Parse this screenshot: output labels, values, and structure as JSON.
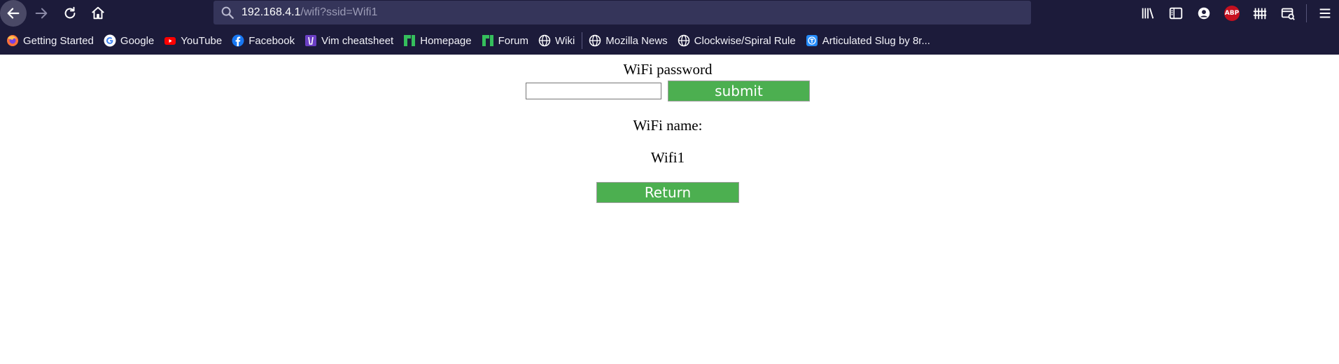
{
  "browser": {
    "url_host": "192.168.4.1",
    "url_path": "/wifi?ssid=Wifi1",
    "icons": [
      "back-arrow-icon",
      "forward-arrow-icon",
      "reload-icon",
      "home-icon",
      "search-icon",
      "library-icon",
      "sidebar-icon",
      "account-icon",
      "adblock-plus-icon",
      "tile-icon",
      "screenshot-icon",
      "menu-icon"
    ],
    "abp_label": "ABP"
  },
  "bookmarks": [
    {
      "label": "Getting Started",
      "icon": "firefox-icon"
    },
    {
      "label": "Google",
      "icon": "google-icon"
    },
    {
      "label": "YouTube",
      "icon": "youtube-icon"
    },
    {
      "label": "Facebook",
      "icon": "facebook-icon"
    },
    {
      "label": "Vim cheatsheet",
      "icon": "vim-icon"
    },
    {
      "label": "Homepage",
      "icon": "manjaro-icon"
    },
    {
      "label": "Forum",
      "icon": "manjaro-icon"
    },
    {
      "label": "Wiki",
      "icon": "globe-icon"
    },
    {
      "label": "Mozilla News",
      "icon": "globe-icon"
    },
    {
      "label": "Clockwise/Spiral Rule",
      "icon": "globe-icon"
    },
    {
      "label": "Articulated Slug by 8r...",
      "icon": "thingiverse-icon"
    }
  ],
  "form": {
    "password_label": "WiFi password",
    "password_value": "",
    "submit_label": "submit",
    "name_label": "WiFi name:",
    "name_value": "Wifi1",
    "return_label": "Return"
  },
  "colors": {
    "chrome_bg": "#1c1b3a",
    "urlbar_bg": "#35355a",
    "button_green": "#4caf50",
    "abp_red": "#c6101f"
  }
}
